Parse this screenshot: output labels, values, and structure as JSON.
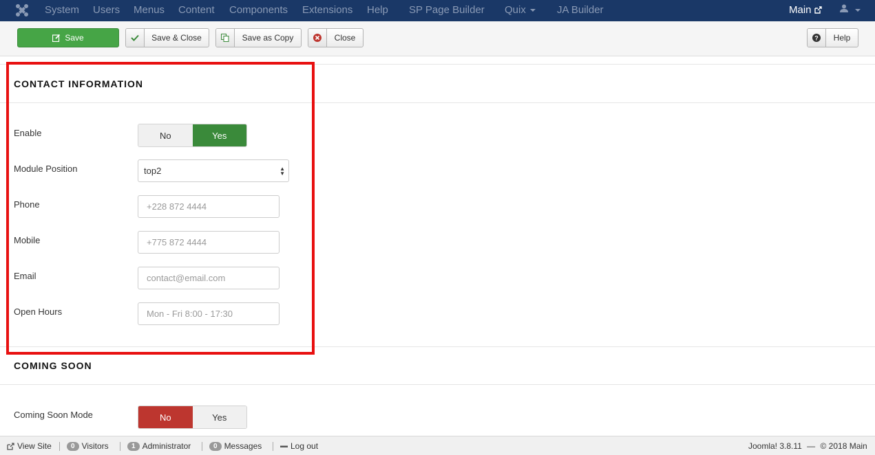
{
  "nav": {
    "items": [
      "System",
      "Users",
      "Menus",
      "Content",
      "Components",
      "Extensions",
      "Help",
      "SP Page Builder",
      "Quix",
      "JA Builder"
    ],
    "site_link": "Main"
  },
  "toolbar": {
    "save": "Save",
    "save_close": "Save & Close",
    "save_copy": "Save as Copy",
    "close": "Close",
    "help": "Help"
  },
  "contact": {
    "title": "CONTACT INFORMATION",
    "enable_label": "Enable",
    "enable_no": "No",
    "enable_yes": "Yes",
    "enable_value": "Yes",
    "position_label": "Module Position",
    "position_value": "top2",
    "phone_label": "Phone",
    "phone_placeholder": "+228 872 4444",
    "mobile_label": "Mobile",
    "mobile_placeholder": "+775 872 4444",
    "email_label": "Email",
    "email_placeholder": "contact@email.com",
    "hours_label": "Open Hours",
    "hours_placeholder": "Mon - Fri 8:00 - 17:30"
  },
  "coming_soon": {
    "title": "COMING SOON",
    "mode_label": "Coming Soon Mode",
    "no": "No",
    "yes": "Yes",
    "value": "No"
  },
  "status": {
    "view_site": "View Site",
    "visitors_count": "0",
    "visitors": "Visitors",
    "admin_count": "1",
    "admin": "Administrator",
    "messages_count": "0",
    "messages": "Messages",
    "logout": "Log out",
    "version": "Joomla! 3.8.11",
    "copyright": "© 2018 Main"
  },
  "colors": {
    "navbar": "#1a3867",
    "save": "#46a546",
    "toggle_yes": "#3a8a3a",
    "toggle_no": "#bd362f",
    "highlight": "#e81010"
  }
}
